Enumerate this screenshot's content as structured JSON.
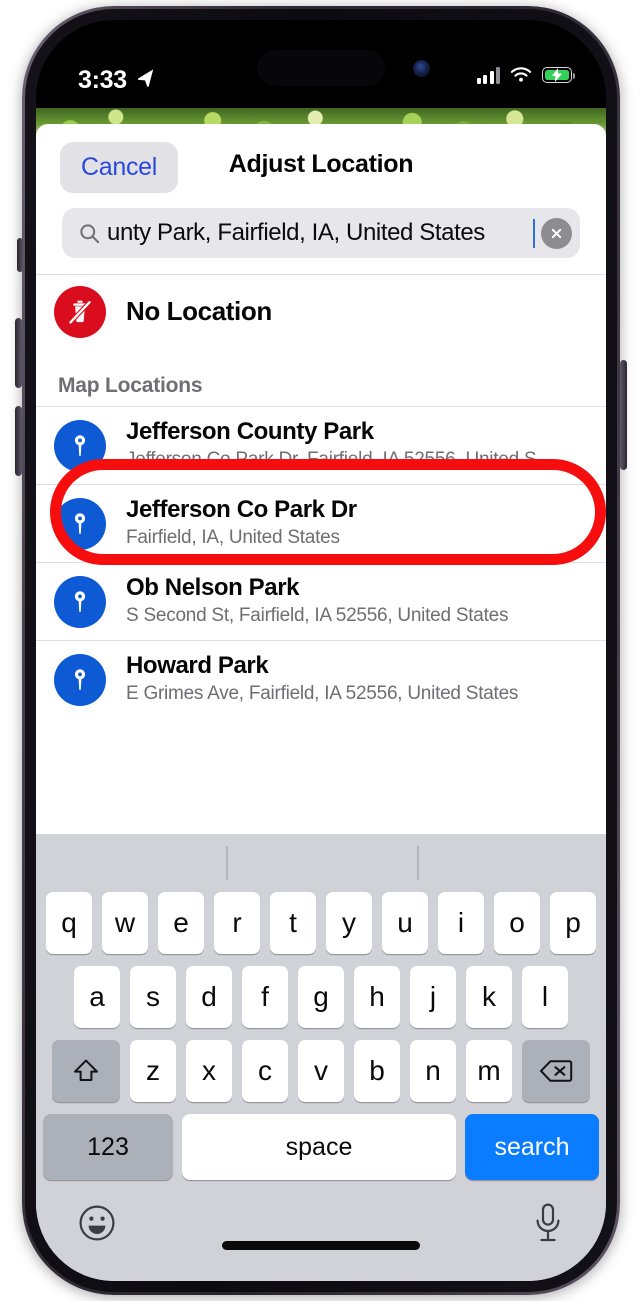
{
  "status_bar": {
    "time": "3:33",
    "location_arrow_icon": "location-arrow-icon",
    "cellular_icon": "signal-bars-icon",
    "wifi_icon": "wifi-icon",
    "battery_icon": "battery-charging-icon"
  },
  "nav": {
    "cancel_label": "Cancel",
    "title": "Adjust Location"
  },
  "search": {
    "icon": "search-icon",
    "value": "unty Park, Fairfield, IA, United States",
    "placeholder": "Search",
    "clear_icon": "clear-circle-icon"
  },
  "no_location": {
    "label": "No Location",
    "icon": "no-location-trash-icon"
  },
  "section": {
    "map_locations_header": "Map Locations"
  },
  "results": [
    {
      "title": "Jefferson County Park",
      "subtitle": "Jefferson Co Park Dr, Fairfield, IA  52556, United S…",
      "icon": "map-pin-icon",
      "highlighted": true
    },
    {
      "title": "Jefferson Co Park Dr",
      "subtitle": "Fairfield, IA, United States",
      "icon": "map-pin-icon",
      "highlighted": false
    },
    {
      "title": "Ob Nelson Park",
      "subtitle": "S Second St, Fairfield, IA  52556, United States",
      "icon": "map-pin-icon",
      "highlighted": false
    },
    {
      "title": "Howard Park",
      "subtitle": "E Grimes Ave, Fairfield, IA  52556, United States",
      "icon": "map-pin-icon",
      "highlighted": false
    }
  ],
  "keyboard": {
    "row1": [
      "q",
      "w",
      "e",
      "r",
      "t",
      "y",
      "u",
      "i",
      "o",
      "p"
    ],
    "row2": [
      "a",
      "s",
      "d",
      "f",
      "g",
      "h",
      "j",
      "k",
      "l"
    ],
    "row3": [
      "z",
      "x",
      "c",
      "v",
      "b",
      "n",
      "m"
    ],
    "shift_icon": "shift-arrow-icon",
    "backspace_icon": "backspace-icon",
    "numbers_label": "123",
    "space_label": "space",
    "search_label": "search",
    "emoji_icon": "emoji-smiley-icon",
    "mic_icon": "microphone-icon"
  },
  "colors": {
    "accent_blue": "#0a7cff",
    "cancel_blue": "#2b48dc",
    "pin_blue": "#0e5ad4",
    "no_location_red": "#d90d1e",
    "annotation_red": "#f60d0d",
    "battery_green": "#33d05a"
  }
}
